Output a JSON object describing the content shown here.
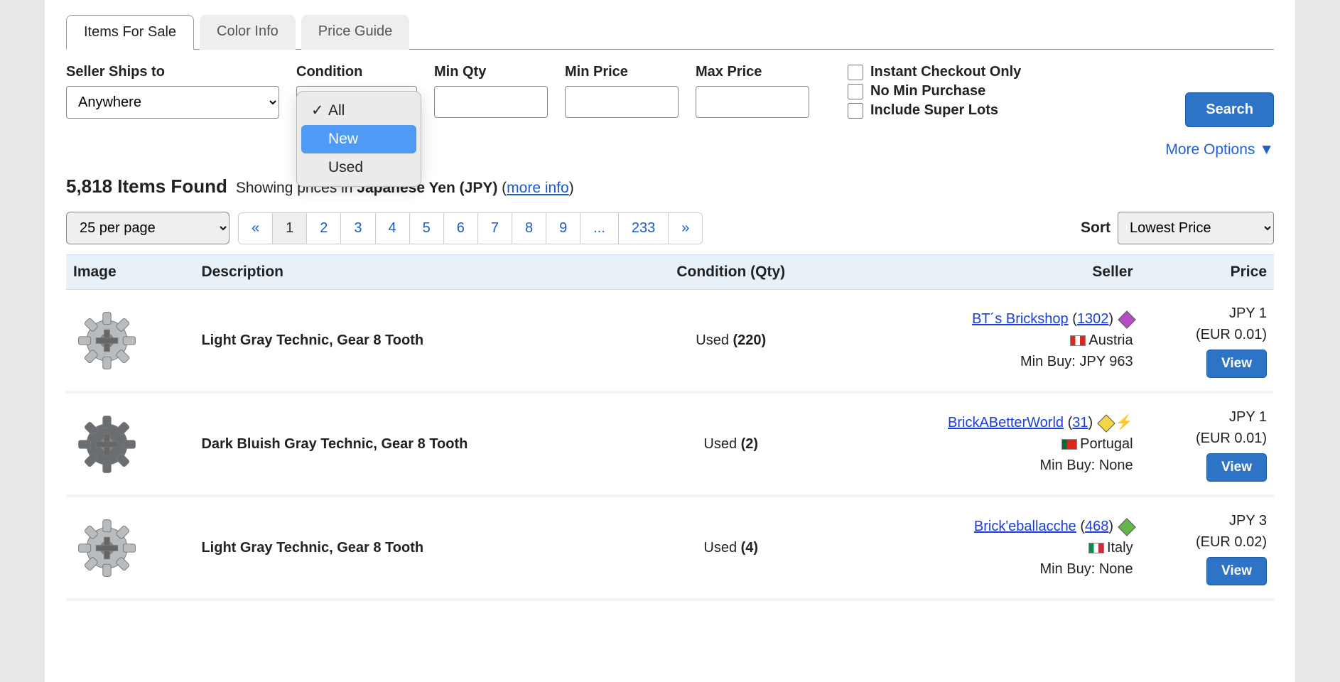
{
  "tabs": {
    "items_for_sale": "Items For Sale",
    "color_info": "Color Info",
    "price_guide": "Price Guide"
  },
  "filters": {
    "ships_to_label": "Seller Ships to",
    "ships_to_value": "Anywhere",
    "condition_label": "Condition",
    "condition_options": {
      "all": "All",
      "new": "New",
      "used": "Used"
    },
    "min_qty_label": "Min Qty",
    "min_price_label": "Min Price",
    "max_price_label": "Max Price",
    "instant_checkout": "Instant Checkout Only",
    "no_min_purchase": "No Min Purchase",
    "include_super_lots": "Include Super Lots",
    "search_btn": "Search",
    "more_options": "More Options ▼"
  },
  "results": {
    "count": "5,818 Items Found",
    "showing_prefix": "Showing prices in ",
    "currency": "Japanese Yen (JPY)",
    "more_info": "more info"
  },
  "toolbar": {
    "per_page": "25 per page",
    "pages": [
      "«",
      "1",
      "2",
      "3",
      "4",
      "5",
      "6",
      "7",
      "8",
      "9",
      "...",
      "233",
      "»"
    ],
    "active_page": "1",
    "sort_label": "Sort",
    "sort_value": "Lowest Price"
  },
  "table": {
    "headers": {
      "image": "Image",
      "description": "Description",
      "condition": "Condition (Qty)",
      "seller": "Seller",
      "price": "Price"
    },
    "view_btn": "View",
    "rows": [
      {
        "description": "Light Gray Technic, Gear 8 Tooth",
        "condition": "Used",
        "qty": "(220)",
        "seller_name": "BT´s Brickshop",
        "seller_feedback": "1302",
        "country": "Austria",
        "flag_colors": [
          "#d52b1e",
          "#ffffff",
          "#d52b1e"
        ],
        "min_buy": "Min Buy: JPY 963",
        "price": "JPY 1",
        "price_alt": "(EUR 0.01)",
        "cube_color": "#b050c0",
        "has_bolt": false,
        "gear_color": "#b9bcbf"
      },
      {
        "description": "Dark Bluish Gray Technic, Gear 8 Tooth",
        "condition": "Used",
        "qty": "(2)",
        "seller_name": "BrickABetterWorld",
        "seller_feedback": "31",
        "country": "Portugal",
        "flag_colors": [
          "#046a38",
          "#da291c",
          "#da291c"
        ],
        "min_buy": "Min Buy: None",
        "price": "JPY 1",
        "price_alt": "(EUR 0.01)",
        "cube_color": "#f5d548",
        "has_bolt": true,
        "gear_color": "#6a6e72"
      },
      {
        "description": "Light Gray Technic, Gear 8 Tooth",
        "condition": "Used",
        "qty": "(4)",
        "seller_name": "Brick'eballacche",
        "seller_feedback": "468",
        "country": "Italy",
        "flag_colors": [
          "#009246",
          "#ffffff",
          "#ce2b37"
        ],
        "min_buy": "Min Buy: None",
        "price": "JPY 3",
        "price_alt": "(EUR 0.02)",
        "cube_color": "#63b74a",
        "has_bolt": false,
        "gear_color": "#b9bcbf"
      }
    ]
  }
}
